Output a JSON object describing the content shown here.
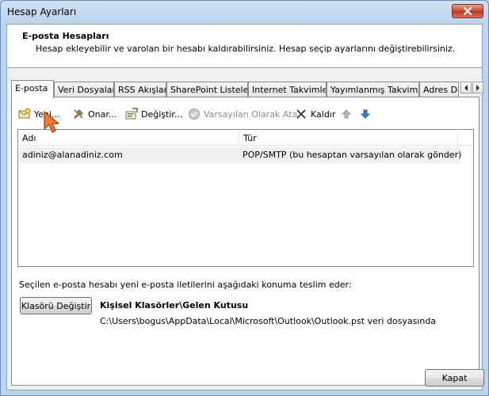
{
  "window": {
    "title": "Hesap Ayarları"
  },
  "header": {
    "title": "E-posta Hesapları",
    "description": "Hesap ekleyebilir ve varolan bir hesabı kaldırabilirsiniz. Hesap seçip ayarlarını değiştirebilirsiniz."
  },
  "tabs": [
    {
      "label": "E-posta"
    },
    {
      "label": "Veri Dosyaları"
    },
    {
      "label": "RSS Akışları"
    },
    {
      "label": "SharePoint Listeleri"
    },
    {
      "label": "Internet Takvimleri"
    },
    {
      "label": "Yayımlanmış Takvimler"
    },
    {
      "label": "Adres Defterleri"
    }
  ],
  "toolbar": {
    "new_label": "Yeni...",
    "repair_label": "Onar...",
    "change_label": "Değiştir...",
    "set_default_label": "Varsayılan Olarak Ata",
    "remove_label": "Kaldır"
  },
  "accounts": {
    "columns": [
      "Adı",
      "Tür"
    ],
    "rows": [
      {
        "name": "adiniz@alanadiniz.com",
        "type": "POP/SMTP (bu hesaptan varsayılan olarak gönder)"
      }
    ]
  },
  "delivery": {
    "label": "Seçilen e-posta hesabı yeni e-posta iletilerini aşağıdaki konuma teslim eder:",
    "change_folder_label": "Klasörü Değiştir",
    "folder_name": "Kişisel Klasörler\\Gelen Kutusu",
    "folder_path": "C:\\Users\\bogus\\AppData\\Local\\Microsoft\\Outlook\\Outlook.pst veri dosyasında"
  },
  "footer": {
    "close_label": "Kapat"
  },
  "colors": {
    "accent": "#3c7fb1",
    "title_bar": "#bcd4ee",
    "close_red": "#c74a33",
    "disabled_text": "#8d8d8d"
  }
}
